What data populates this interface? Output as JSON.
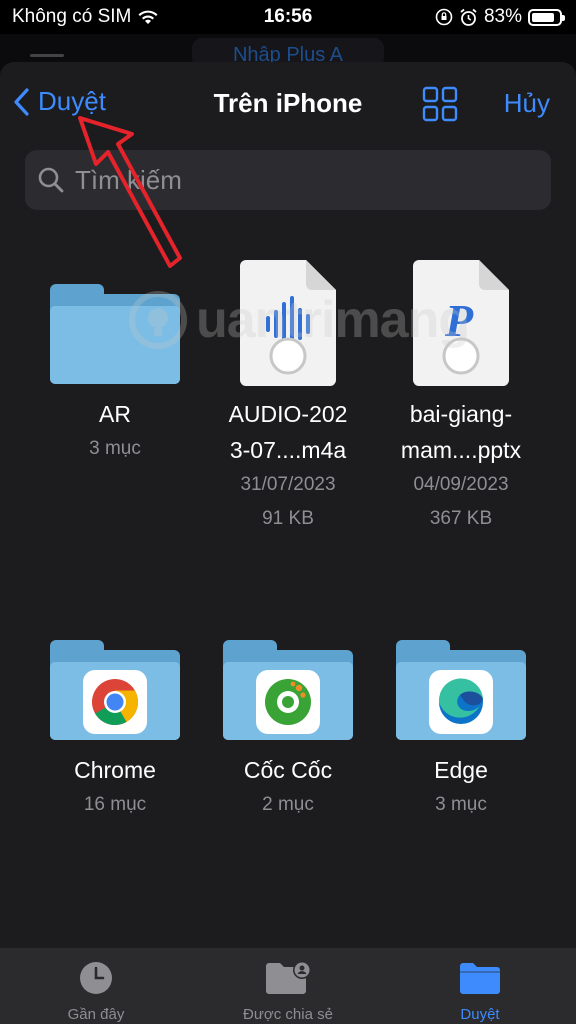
{
  "status_bar": {
    "carrier": "Không có SIM",
    "time": "16:56",
    "battery": "83%",
    "battery_level": 0.83
  },
  "behind": {
    "title": "Nhập Plus A"
  },
  "nav": {
    "back_label": "Duyệt",
    "title": "Trên iPhone",
    "cancel_label": "Hủy"
  },
  "search": {
    "placeholder": "Tìm kiếm"
  },
  "items": [
    {
      "name": "AR",
      "meta1": "3 mục",
      "kind": "folder"
    },
    {
      "name_line1": "AUDIO-202",
      "name_line2": "3-07....m4a",
      "date": "31/07/2023",
      "size": "91 KB",
      "kind": "audio"
    },
    {
      "name_line1": "bai-giang-",
      "name_line2": "mam....pptx",
      "date": "04/09/2023",
      "size": "367 KB",
      "kind": "pptx"
    },
    {
      "name": "Chrome",
      "meta1": "16 mục",
      "kind": "folder",
      "app": "chrome-icon"
    },
    {
      "name": "Cốc Cốc",
      "meta1": "2 mục",
      "kind": "folder",
      "app": "coccoc-icon"
    },
    {
      "name": "Edge",
      "meta1": "3 mục",
      "kind": "folder",
      "app": "edge-icon"
    }
  ],
  "tabbar": {
    "recent": "Gần đây",
    "shared": "Được chia sẻ",
    "browse": "Duyệt"
  },
  "colors": {
    "accent": "#3d8bfd",
    "sheet_bg": "#1c1c1e",
    "folder": "#7cbde6",
    "annotation_arrow": "#e5232b"
  }
}
